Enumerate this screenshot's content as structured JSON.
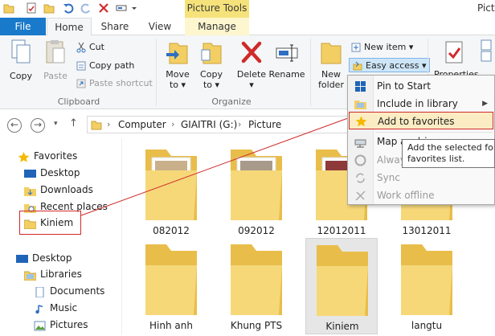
{
  "window": {
    "title": "Pictu",
    "contextual_group": "Picture Tools"
  },
  "tabs": {
    "file": "File",
    "home": "Home",
    "share": "Share",
    "view": "View",
    "manage": "Manage"
  },
  "ribbon": {
    "clipboard": {
      "label": "Clipboard",
      "copy": "Copy",
      "paste": "Paste",
      "cut": "Cut",
      "copy_path": "Copy path",
      "paste_shortcut": "Paste shortcut"
    },
    "organize": {
      "label": "Organize",
      "move_to": "Move",
      "move_to_2": "to",
      "copy_to": "Copy",
      "copy_to_2": "to",
      "delete": "Delete",
      "rename": "Rename"
    },
    "new": {
      "new_folder": "New",
      "new_folder_2": "folder",
      "new_item": "New item",
      "easy_access": "Easy access"
    },
    "open": {
      "properties": "Properties"
    }
  },
  "address": {
    "crumbs": [
      "Computer",
      "GIAITRI (G:)",
      "Picture"
    ]
  },
  "nav": {
    "favorites": "Favorites",
    "desktop": "Desktop",
    "downloads": "Downloads",
    "recent_places": "Recent places",
    "kiniem": "Kiniem",
    "desktop2": "Desktop",
    "libraries": "Libraries",
    "documents": "Documents",
    "music": "Music",
    "pictures": "Pictures"
  },
  "folders": [
    {
      "name": "082012"
    },
    {
      "name": "092012"
    },
    {
      "name": "12012011"
    },
    {
      "name": "13012011"
    },
    {
      "name": "Hinh anh"
    },
    {
      "name": "Khung PTS"
    },
    {
      "name": "Kiniem"
    },
    {
      "name": "langtu"
    }
  ],
  "menu": {
    "pin_to_start": "Pin to Start",
    "include_in_library": "Include in library",
    "add_to_favorites": "Add to favorites",
    "map_drive": "Map as drive",
    "always_offline": "Always available offline",
    "sync": "Sync",
    "work_offline": "Work offline"
  },
  "tooltip": {
    "line1": "Add the selected folder to the",
    "line2": "favorites list."
  },
  "colors": {
    "file_tab": "#1979ca",
    "highlight_red": "#d02a2a",
    "folder_yellow": "#f3cf63"
  }
}
